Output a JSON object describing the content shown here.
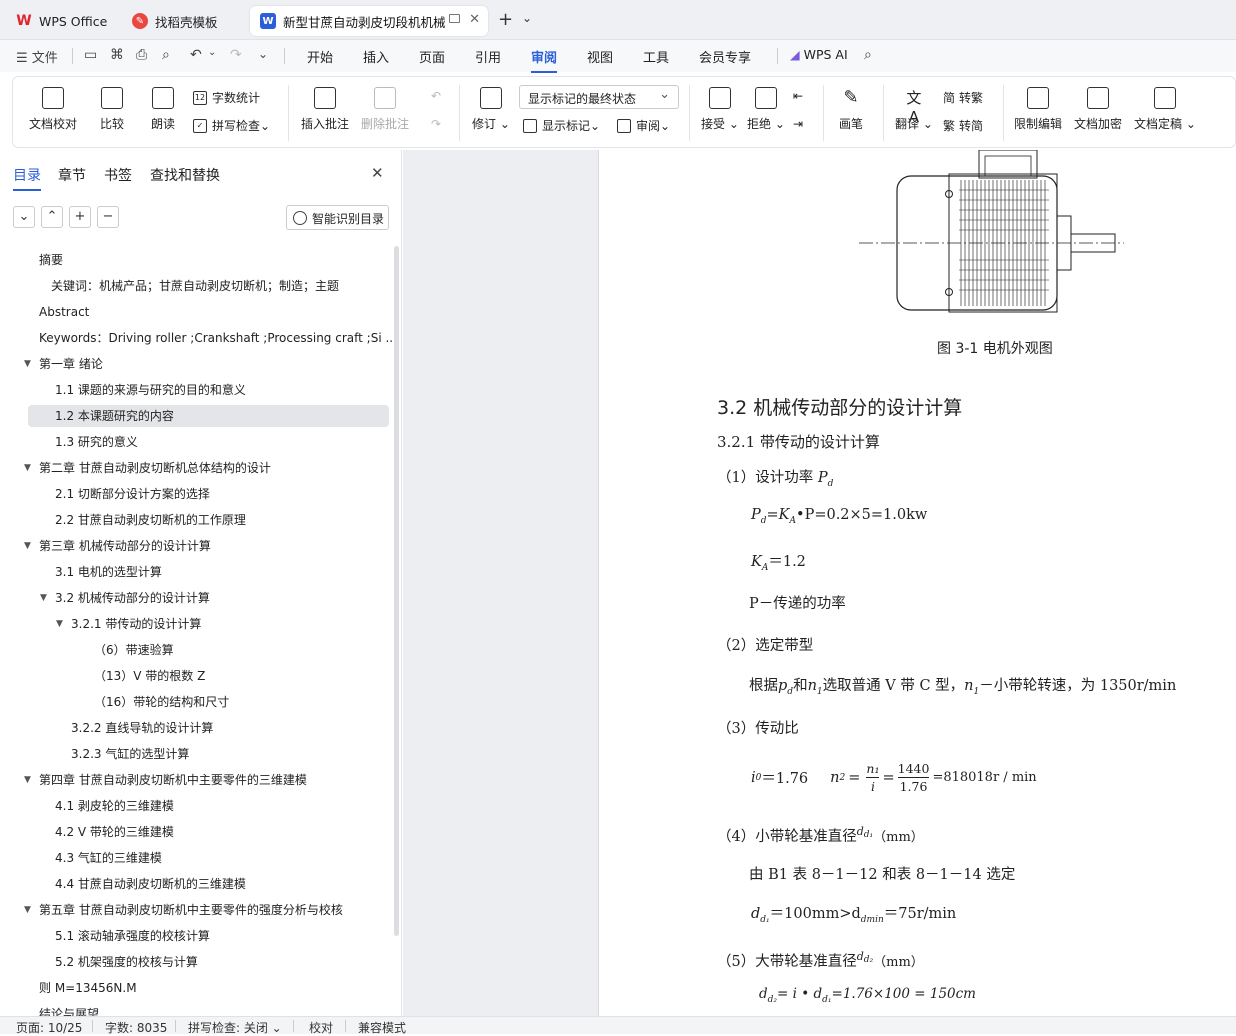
{
  "tabs": [
    {
      "label": "WPS Office"
    },
    {
      "label": "找稻壳模板"
    },
    {
      "label": "新型甘蔗自动剥皮切段机机械"
    }
  ],
  "new_tab": "+",
  "menu": {
    "file": "文件",
    "items": [
      "开始",
      "插入",
      "页面",
      "引用",
      "审阅",
      "视图",
      "工具",
      "会员专享"
    ],
    "ai": "WPS AI"
  },
  "ribbon": {
    "doc_proof": "文档校对",
    "compare": "比较",
    "read_aloud": "朗读",
    "word_count": "字数统计",
    "spell_check": "拼写检查",
    "insert_comment": "插入批注",
    "delete_comment": "删除批注",
    "revise": "修订",
    "markup_state": "显示标记的最终状态",
    "show_markup": "显示标记",
    "review": "审阅",
    "accept": "接受",
    "reject": "拒绝",
    "pen": "画笔",
    "translate": "翻译",
    "to_traditional": "转繁",
    "to_simplified": "转简",
    "restrict_edit": "限制编辑",
    "encrypt": "文档加密",
    "finalize": "文档定稿"
  },
  "panel": {
    "tabs": [
      "目录",
      "章节",
      "书签",
      "查找和替换"
    ],
    "smart_toc": "智能识别目录",
    "toc": [
      {
        "label": "摘要",
        "level": 0
      },
      {
        "label": "关键词：机械产品；甘蔗自动剥皮切断机；制造；主题",
        "level": 0.5
      },
      {
        "label": "Abstract",
        "level": 0
      },
      {
        "label": "Keywords：Driving roller ;Crankshaft ;Processing craft ;Si ...",
        "level": 0
      },
      {
        "label": "第一章  绪论",
        "level": 0,
        "caret": true
      },
      {
        "label": "1.1  课题的来源与研究的目的和意义",
        "level": 1
      },
      {
        "label": "1.2  本课题研究的内容",
        "level": 1,
        "selected": true
      },
      {
        "label": "1.3  研究的意义",
        "level": 1
      },
      {
        "label": "第二章  甘蔗自动剥皮切断机总体结构的设计",
        "level": 0,
        "caret": true
      },
      {
        "label": "2.1 切断部分设计方案的选择",
        "level": 1
      },
      {
        "label": "2.2 甘蔗自动剥皮切断机的工作原理",
        "level": 1
      },
      {
        "label": "第三章  机械传动部分的设计计算",
        "level": 0,
        "caret": true
      },
      {
        "label": "3.1 电机的选型计算",
        "level": 1
      },
      {
        "label": "3.2  机械传动部分的设计计算",
        "level": 1,
        "caret": true
      },
      {
        "label": "3.2.1  带传动的设计计算",
        "level": 2,
        "caret": true
      },
      {
        "label": "（6）带速验算",
        "level": 3
      },
      {
        "label": "（13）V 带的根数 Z",
        "level": 3
      },
      {
        "label": "（16）带轮的结构和尺寸",
        "level": 3
      },
      {
        "label": "3.2.2 直线导轨的设计计算",
        "level": 2
      },
      {
        "label": "3.2.3  气缸的选型计算",
        "level": 2
      },
      {
        "label": "第四章  甘蔗自动剥皮切断机中主要零件的三维建模",
        "level": 0,
        "caret": true
      },
      {
        "label": "4.1 剥皮轮的三维建模",
        "level": 1
      },
      {
        "label": "4.2 V 带轮的三维建模",
        "level": 1
      },
      {
        "label": "4.3 气缸的三维建模",
        "level": 1
      },
      {
        "label": "4.4 甘蔗自动剥皮切断机的三维建模",
        "level": 1
      },
      {
        "label": "第五章  甘蔗自动剥皮切断机中主要零件的强度分析与校核",
        "level": 0,
        "caret": true
      },
      {
        "label": "5.1 滚动轴承强度的校核计算",
        "level": 1
      },
      {
        "label": "5.2 机架强度的校核与计算",
        "level": 1
      },
      {
        "label": "则 M=13456N.M",
        "level": 0
      },
      {
        "label": "结论与展望",
        "level": 0
      }
    ]
  },
  "document": {
    "figure_caption": "图 3-1  电机外观图",
    "heading_32": "3.2  机械传动部分的设计计算",
    "heading_321": "3.2.1 带传动的设计计算",
    "s1": "（1）设计功率",
    "s1_sym": "P",
    "s1_sub": "d",
    "eq1_lhs": "P",
    "eq1_lhs_sub": "d",
    "eq1_mid": "=K",
    "eq1_mid_sub": "A",
    "eq1_rhs": "•P=0.2×5=1.0kw",
    "eq2_sym": "K",
    "eq2_sub": "A",
    "eq2_val": "＝1.2",
    "p_desc": "P－传递的功率",
    "s2": "（2）选定带型",
    "s2_text_pre": "根据",
    "s2_text_sym1": "p",
    "s2_text_sub1": "d",
    "s2_text_and": "和",
    "s2_text_sym2": "n",
    "s2_text_sub2": "1",
    "s2_text_mid": "选取普通 V 带 C 型，",
    "s2_text_sym3": "n",
    "s2_text_sub3": "1",
    "s2_text_end": "－小带轮转速，为 1350r/min",
    "s3": "（3）传动比",
    "i0_sym": "i",
    "i0_sub": "0",
    "i0_val": "＝1.76",
    "n2_sym": "n",
    "n2_sub": "2",
    "n2_eq": "=",
    "n2_frac1_num": "n₁",
    "n2_frac1_den": "i",
    "n2_frac2_num": "1440",
    "n2_frac2_den": "1.76",
    "n2_result": "=818018r / min",
    "s4": "（4）小带轮基准直径",
    "s4_sym": "d",
    "s4_unit": "（mm）",
    "s4_text": "由 B1 表 8－1－12 和表 8－1－14 选定",
    "s4_eq_sym": "d",
    "s4_eq_mid": "＝100mm>d",
    "s4_eq_end": "＝75r/min",
    "s5": "（5）大带轮基准直径",
    "s5_sym": "d",
    "s5_unit": "（mm）",
    "s5_eq_sym": "d",
    "s5_eq_rest": "= i • d",
    "s5_eq_end": "=1.76×100 = 150cm"
  },
  "status": {
    "page": "页面: 10/25",
    "words": "字数: 8035",
    "spell": "拼写检查: 关闭",
    "proof": "校对",
    "compat": "兼容模式"
  },
  "colors": {
    "accent": "#2b5fd9",
    "wps_red": "#e0242f",
    "word_blue": "#2b5fd9",
    "docer_red": "#e9473f"
  }
}
